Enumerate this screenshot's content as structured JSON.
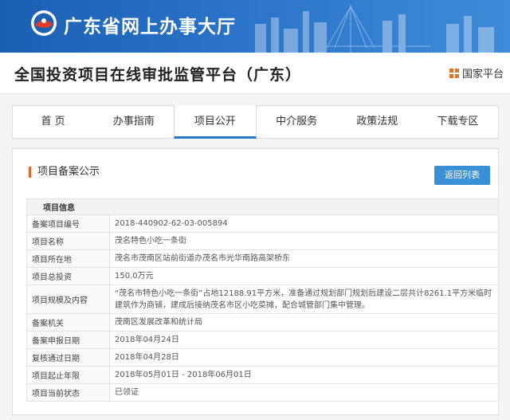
{
  "banner": {
    "title": "广东省网上办事大厅"
  },
  "subheader": {
    "platform_title": "全国投资项目在线审批监管平台（广东）",
    "national_label": "国家平台"
  },
  "nav": {
    "items": [
      {
        "label": "首 页"
      },
      {
        "label": "办事指南"
      },
      {
        "label": "项目公开"
      },
      {
        "label": "中介服务"
      },
      {
        "label": "政策法规"
      },
      {
        "label": "下载专区"
      }
    ],
    "active_index": 2
  },
  "panel": {
    "section_title": "项目备案公示",
    "back_button": "返回列表",
    "group_header": "项目信息",
    "rows": [
      {
        "label": "备案项目编号",
        "value": "2018-440902-62-03-005894"
      },
      {
        "label": "项目名称",
        "value": "茂名特色小吃一条街"
      },
      {
        "label": "项目所在地",
        "value": "茂名市茂南区站前街道办茂名市光华南路高架桥东"
      },
      {
        "label": "项目总投资",
        "value": "150.0万元"
      },
      {
        "label": "项目规模及内容",
        "value": "“茂名市特色小吃一条街”占地12188.91平方米，准备通过规划部门规划后建设二层共计8261.1平方米临时建筑作为商铺，建成后接纳茂名市区小吃菜摊，配合城管部门集中管理。"
      },
      {
        "label": "备案机关",
        "value": "茂南区发展改革和统计局"
      },
      {
        "label": "备案申报日期",
        "value": "2018年04月24日"
      },
      {
        "label": "复核通过日期",
        "value": "2018年04月28日"
      },
      {
        "label": "项目起止年限",
        "value": "2018年05月01日 - 2018年06月01日"
      },
      {
        "label": "项目当前状态",
        "value": "已领证"
      }
    ]
  },
  "colors": {
    "banner": "#2a73c9",
    "accent": "#2a77c8",
    "button": "#3a90d4",
    "section_marker": "#e06b2a"
  }
}
